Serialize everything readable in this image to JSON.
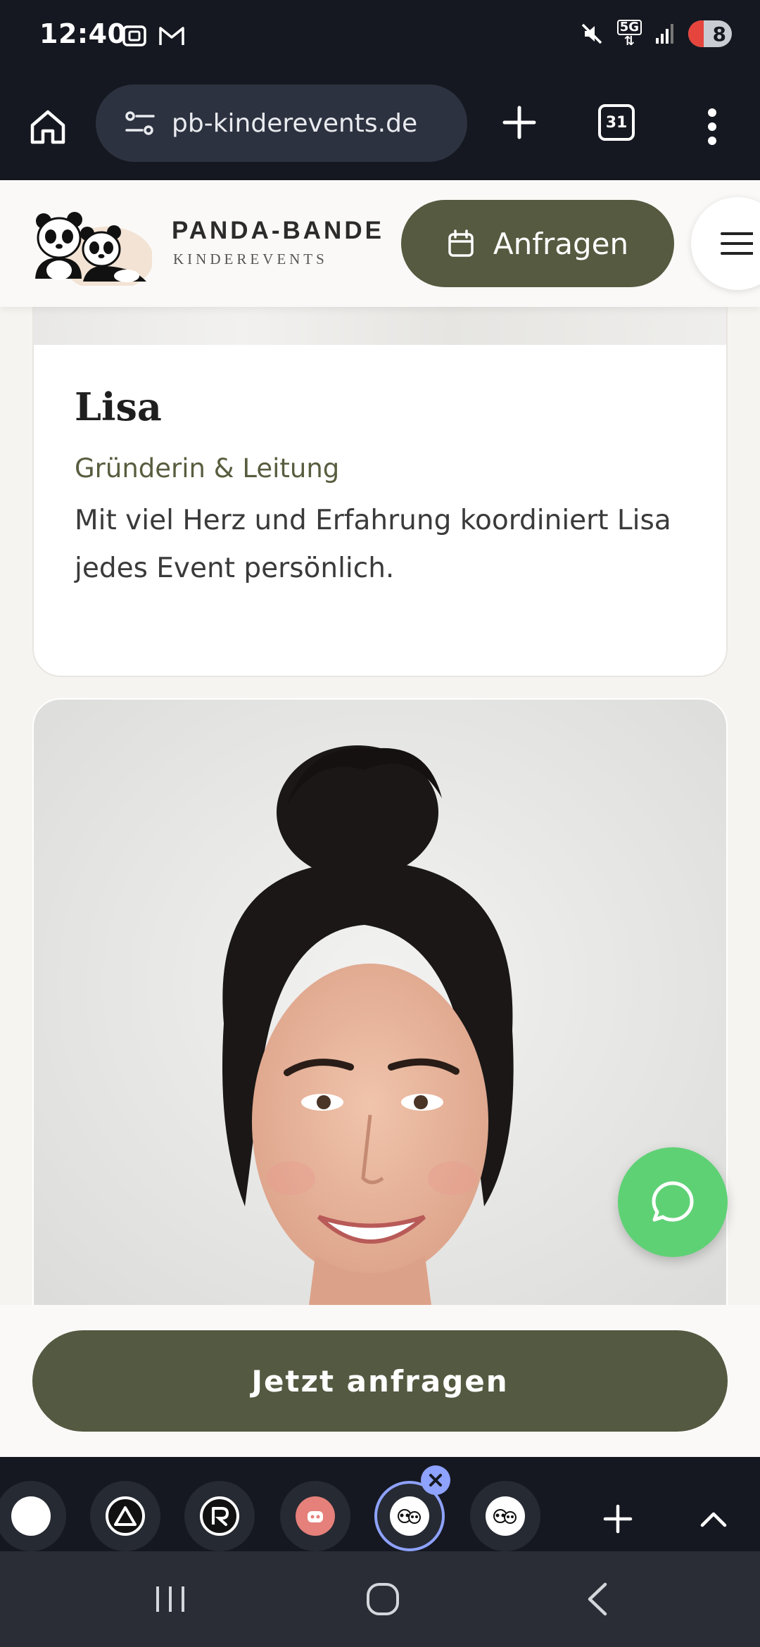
{
  "status_bar": {
    "time": "12:40",
    "network": "5G",
    "battery": "8"
  },
  "browser": {
    "url": "pb-kinderevents.de",
    "tab_count": "31"
  },
  "site_header": {
    "brand_name": "PANDA-BANDE",
    "brand_sub": "KINDEREVENTS",
    "cta_label": "Anfragen"
  },
  "team_card": {
    "name": "Lisa",
    "role": "Gründerin & Leitung",
    "description": "Mit viel Herz und Erfahrung koordiniert Lisa jedes Event persönlich."
  },
  "sticky_cta": {
    "label": "Jetzt anfragen"
  },
  "colors": {
    "brand_olive": "#555a40",
    "whatsapp_green": "#5fd175",
    "browser_dark": "#151820"
  }
}
